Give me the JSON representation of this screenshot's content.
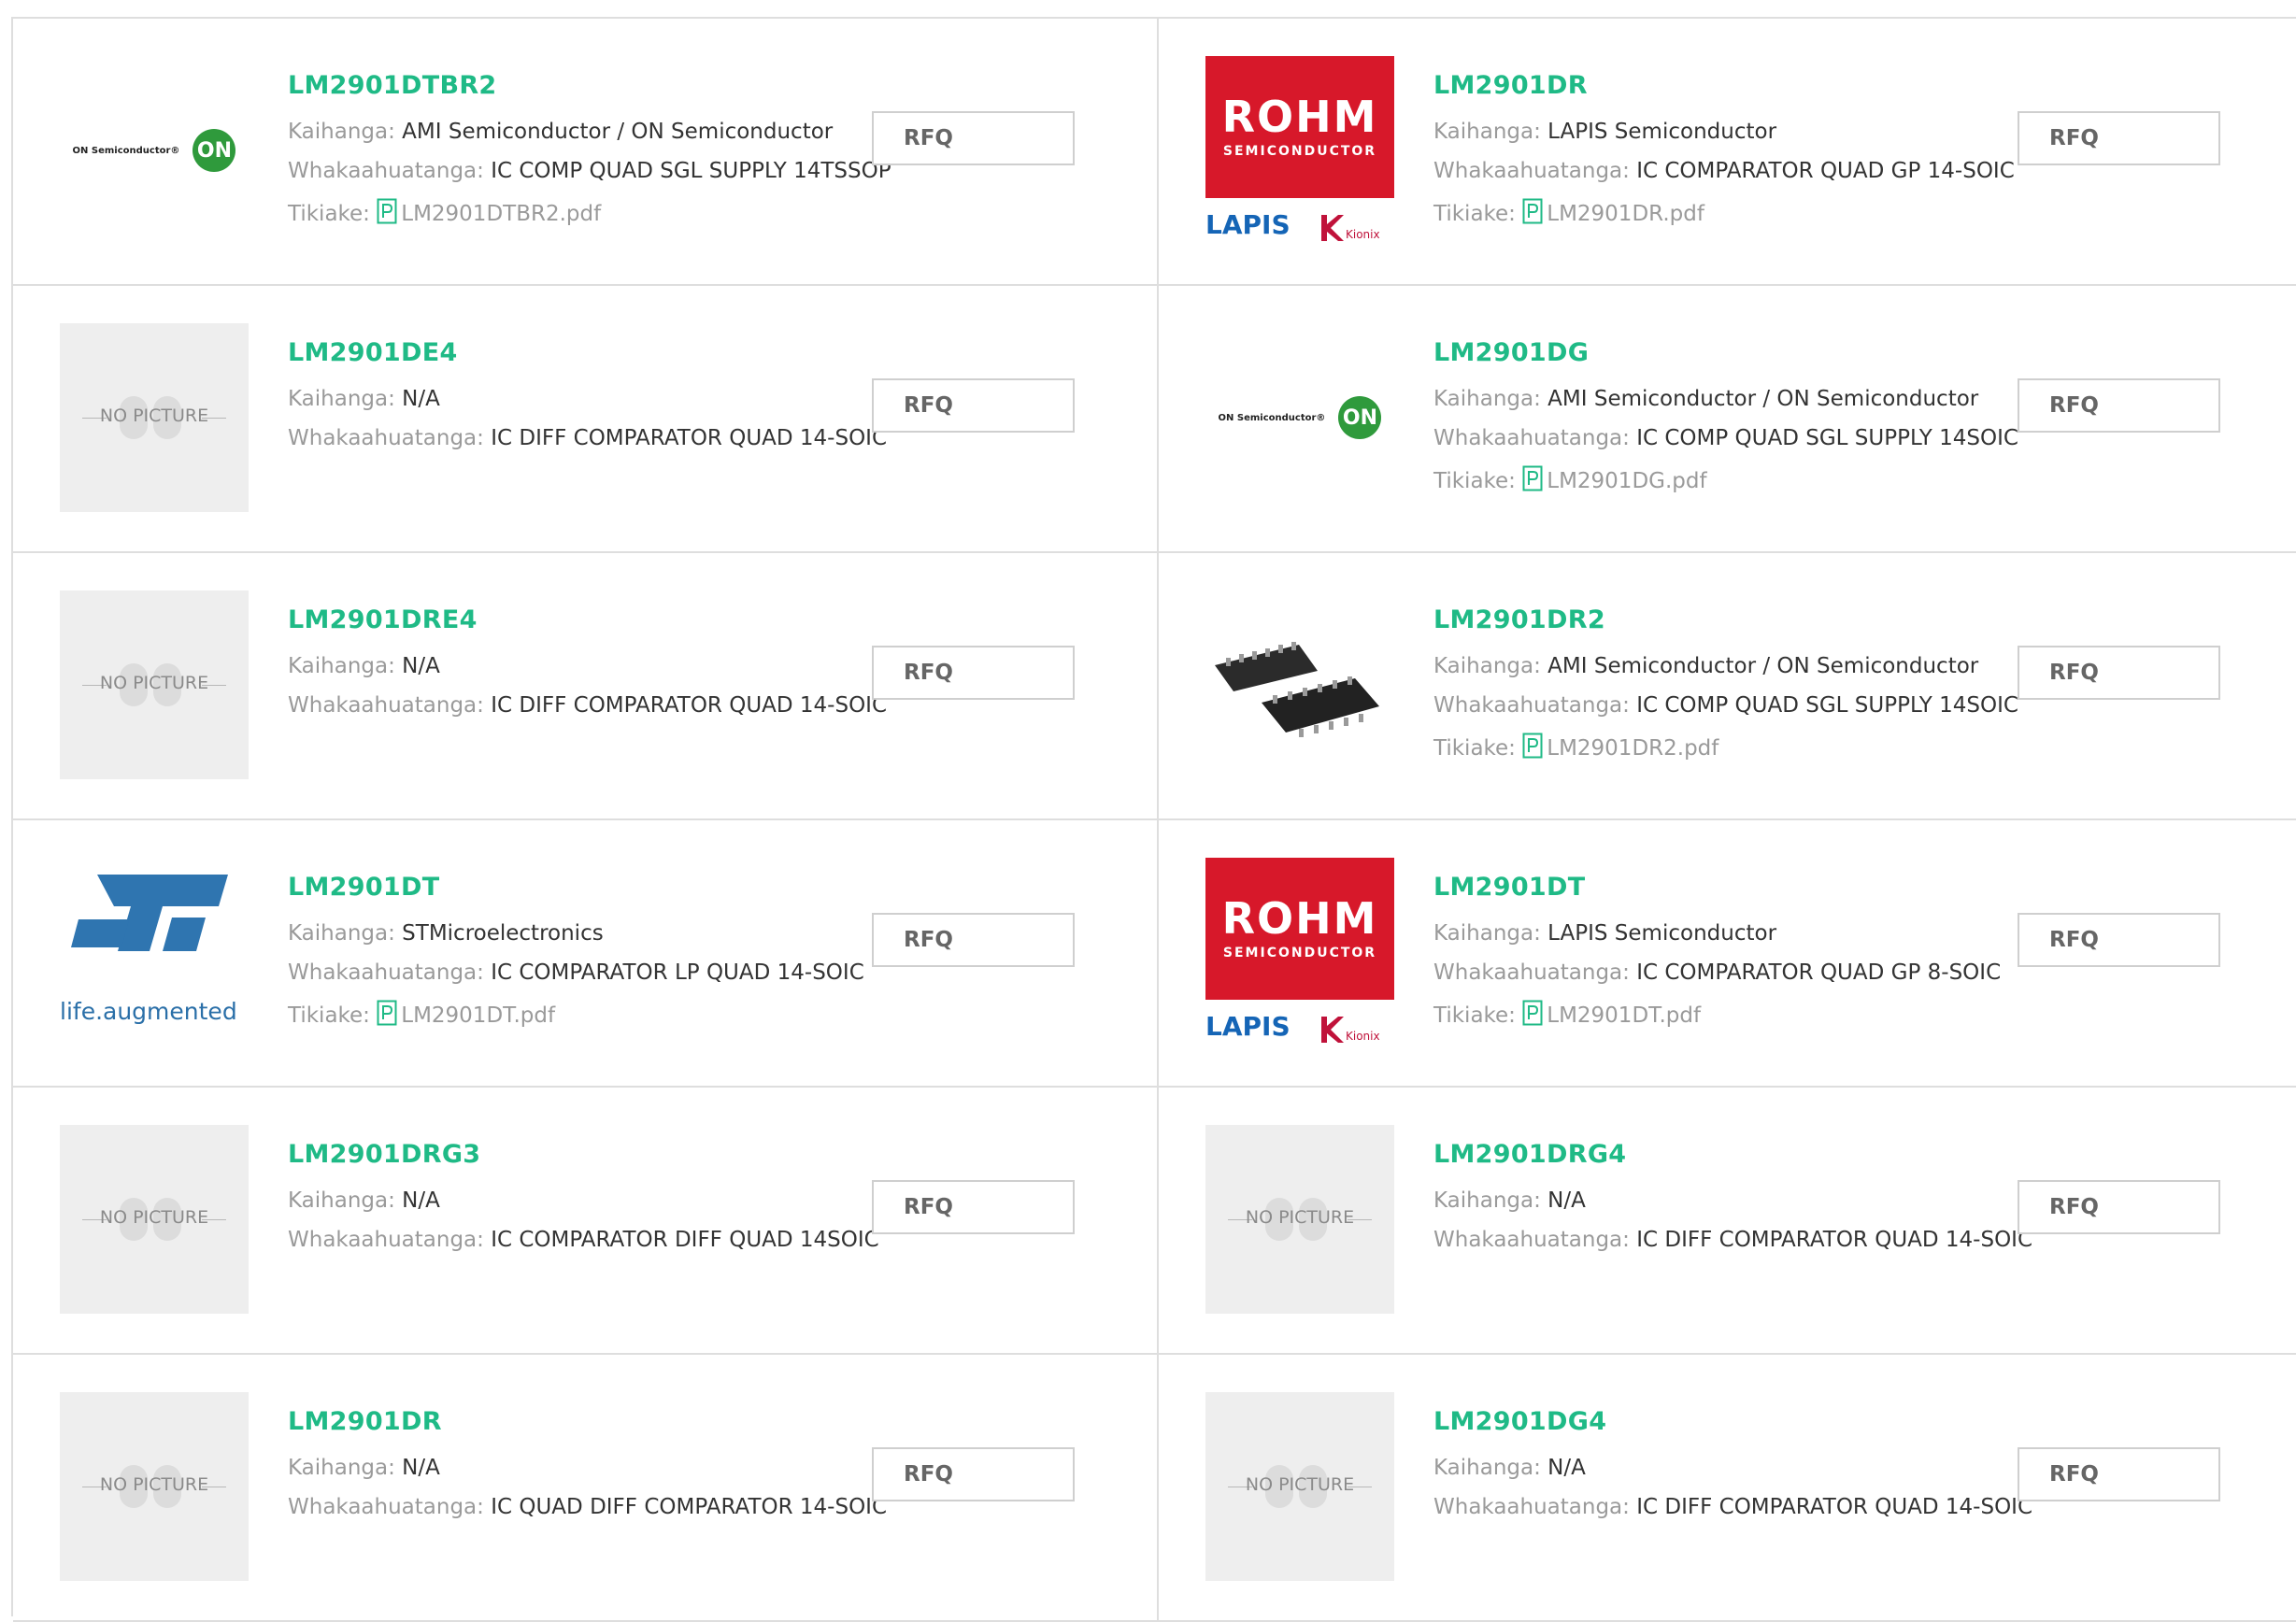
{
  "labels": {
    "manufacturer": "Kaihanga:",
    "description": "Whakaahuatanga:",
    "datasheet": "Tikiake:",
    "rfq": "RFQ"
  },
  "logos": {
    "on": "ON Semiconductor®",
    "on_mark": "ON",
    "rohm": "ROHM",
    "rohm_sub": "SEMICONDUCTOR",
    "lapis": "LAPIS",
    "kionix": "Kionix",
    "st_tagline": "life.augmented",
    "nopic": "NO PICTURE"
  },
  "products": [
    {
      "part": "LM2901DTBR2",
      "image": "on-semi-logo",
      "manufacturer": "AMI Semiconductor / ON Semiconductor",
      "description": "IC COMP QUAD SGL SUPPLY 14TSSOP",
      "pdf": "LM2901DTBR2.pdf"
    },
    {
      "part": "LM2901DR",
      "image": "rohm-lapis-logo",
      "manufacturer": "LAPIS Semiconductor",
      "description": "IC COMPARATOR QUAD GP 14-SOIC",
      "pdf": "LM2901DR.pdf"
    },
    {
      "part": "LM2901DE4",
      "image": "no-picture",
      "manufacturer": "N/A",
      "description": "IC DIFF COMPARATOR QUAD 14-SOIC",
      "pdf": ""
    },
    {
      "part": "LM2901DG",
      "image": "on-semi-logo",
      "manufacturer": "AMI Semiconductor / ON Semiconductor",
      "description": "IC COMP QUAD SGL SUPPLY 14SOIC",
      "pdf": "LM2901DG.pdf"
    },
    {
      "part": "LM2901DRE4",
      "image": "no-picture",
      "manufacturer": "N/A",
      "description": "IC DIFF COMPARATOR QUAD 14-SOIC",
      "pdf": ""
    },
    {
      "part": "LM2901DR2",
      "image": "chip-photo",
      "manufacturer": "AMI Semiconductor / ON Semiconductor",
      "description": "IC COMP QUAD SGL SUPPLY 14SOIC",
      "pdf": "LM2901DR2.pdf"
    },
    {
      "part": "LM2901DT",
      "image": "st-logo",
      "manufacturer": "STMicroelectronics",
      "description": "IC COMPARATOR LP QUAD 14-SOIC",
      "pdf": "LM2901DT.pdf"
    },
    {
      "part": "LM2901DT",
      "image": "rohm-lapis-logo",
      "manufacturer": "LAPIS Semiconductor",
      "description": "IC COMPARATOR QUAD GP 8-SOIC",
      "pdf": "LM2901DT.pdf"
    },
    {
      "part": "LM2901DRG3",
      "image": "no-picture",
      "manufacturer": "N/A",
      "description": "IC COMPARATOR DIFF QUAD 14SOIC",
      "pdf": ""
    },
    {
      "part": "LM2901DRG4",
      "image": "no-picture",
      "manufacturer": "N/A",
      "description": "IC DIFF COMPARATOR QUAD 14-SOIC",
      "pdf": ""
    },
    {
      "part": "LM2901DR",
      "image": "no-picture",
      "manufacturer": "N/A",
      "description": "IC QUAD DIFF COMPARATOR 14-SOIC",
      "pdf": ""
    },
    {
      "part": "LM2901DG4",
      "image": "no-picture",
      "manufacturer": "N/A",
      "description": "IC DIFF COMPARATOR QUAD 14-SOIC",
      "pdf": ""
    }
  ]
}
